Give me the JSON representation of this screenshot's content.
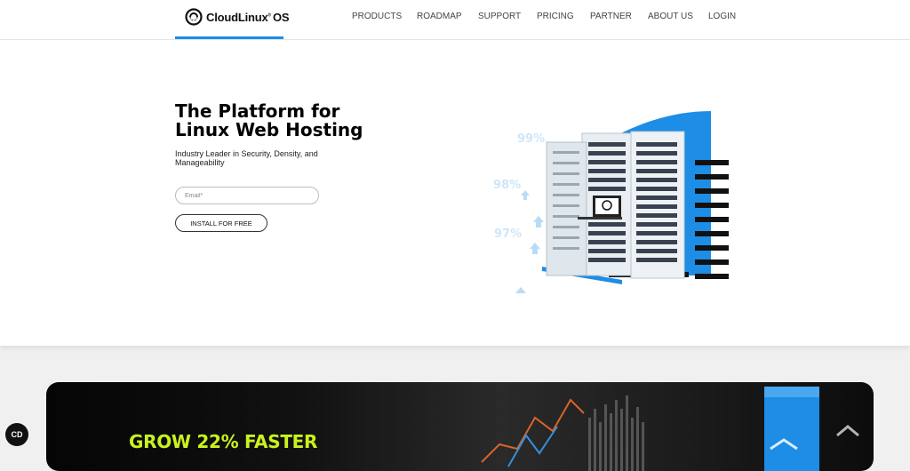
{
  "header": {
    "logo_text": "CloudLinux",
    "logo_suffix": "OS",
    "nav": [
      "PRODUCTS",
      "ROADMAP",
      "SUPPORT",
      "PRICING",
      "PARTNER",
      "ABOUT US",
      "LOGIN"
    ]
  },
  "hero": {
    "title_line1": "The Platform for",
    "title_line2": "Linux Web Hosting",
    "subtitle": "Industry Leader in Security, Density, and Manageability",
    "email_placeholder": "Email*",
    "cta_label": "INSTALL FOR FREE",
    "stats": [
      "99%",
      "98%",
      "97%"
    ]
  },
  "promo": {
    "title": "GROW 22% FASTER"
  },
  "chat": {
    "label": "CD"
  },
  "colors": {
    "accent_blue": "#1d8de6",
    "promo_lime": "#c8f31d",
    "stat_blue": "#cfe6f8"
  }
}
